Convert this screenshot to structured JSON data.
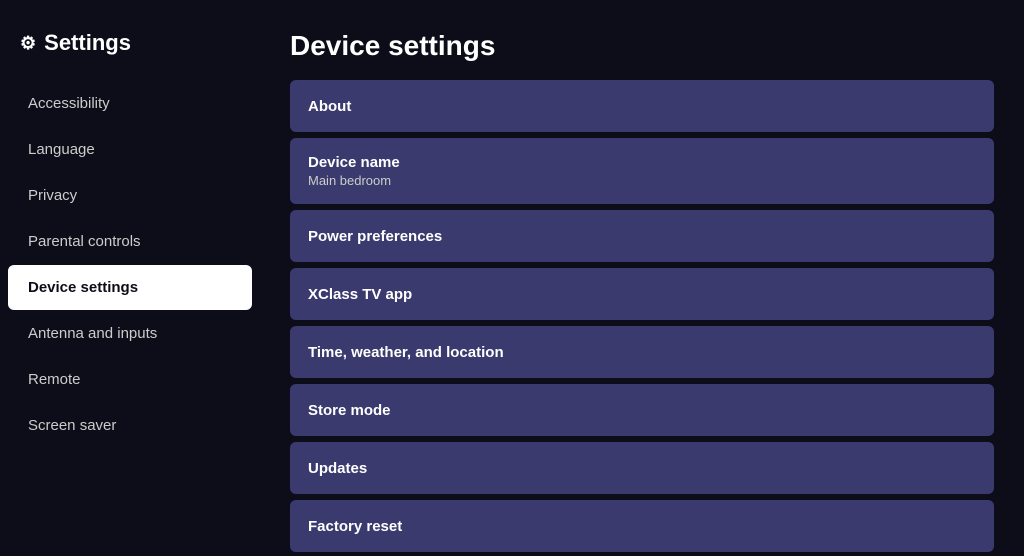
{
  "sidebar": {
    "title": "Settings",
    "gear_icon": "⚙",
    "items": [
      {
        "label": "Accessibility",
        "active": false
      },
      {
        "label": "Language",
        "active": false
      },
      {
        "label": "Privacy",
        "active": false
      },
      {
        "label": "Parental controls",
        "active": false
      },
      {
        "label": "Device settings",
        "active": true
      },
      {
        "label": "Antenna and inputs",
        "active": false
      },
      {
        "label": "Remote",
        "active": false
      },
      {
        "label": "Screen saver",
        "active": false
      }
    ]
  },
  "main": {
    "page_title": "Device settings",
    "settings_items": [
      {
        "label": "About",
        "sublabel": ""
      },
      {
        "label": "Device name",
        "sublabel": "Main bedroom"
      },
      {
        "label": "Power preferences",
        "sublabel": ""
      },
      {
        "label": "XClass TV app",
        "sublabel": ""
      },
      {
        "label": "Time, weather, and location",
        "sublabel": ""
      },
      {
        "label": "Store mode",
        "sublabel": ""
      },
      {
        "label": "Updates",
        "sublabel": ""
      },
      {
        "label": "Factory reset",
        "sublabel": ""
      }
    ]
  }
}
